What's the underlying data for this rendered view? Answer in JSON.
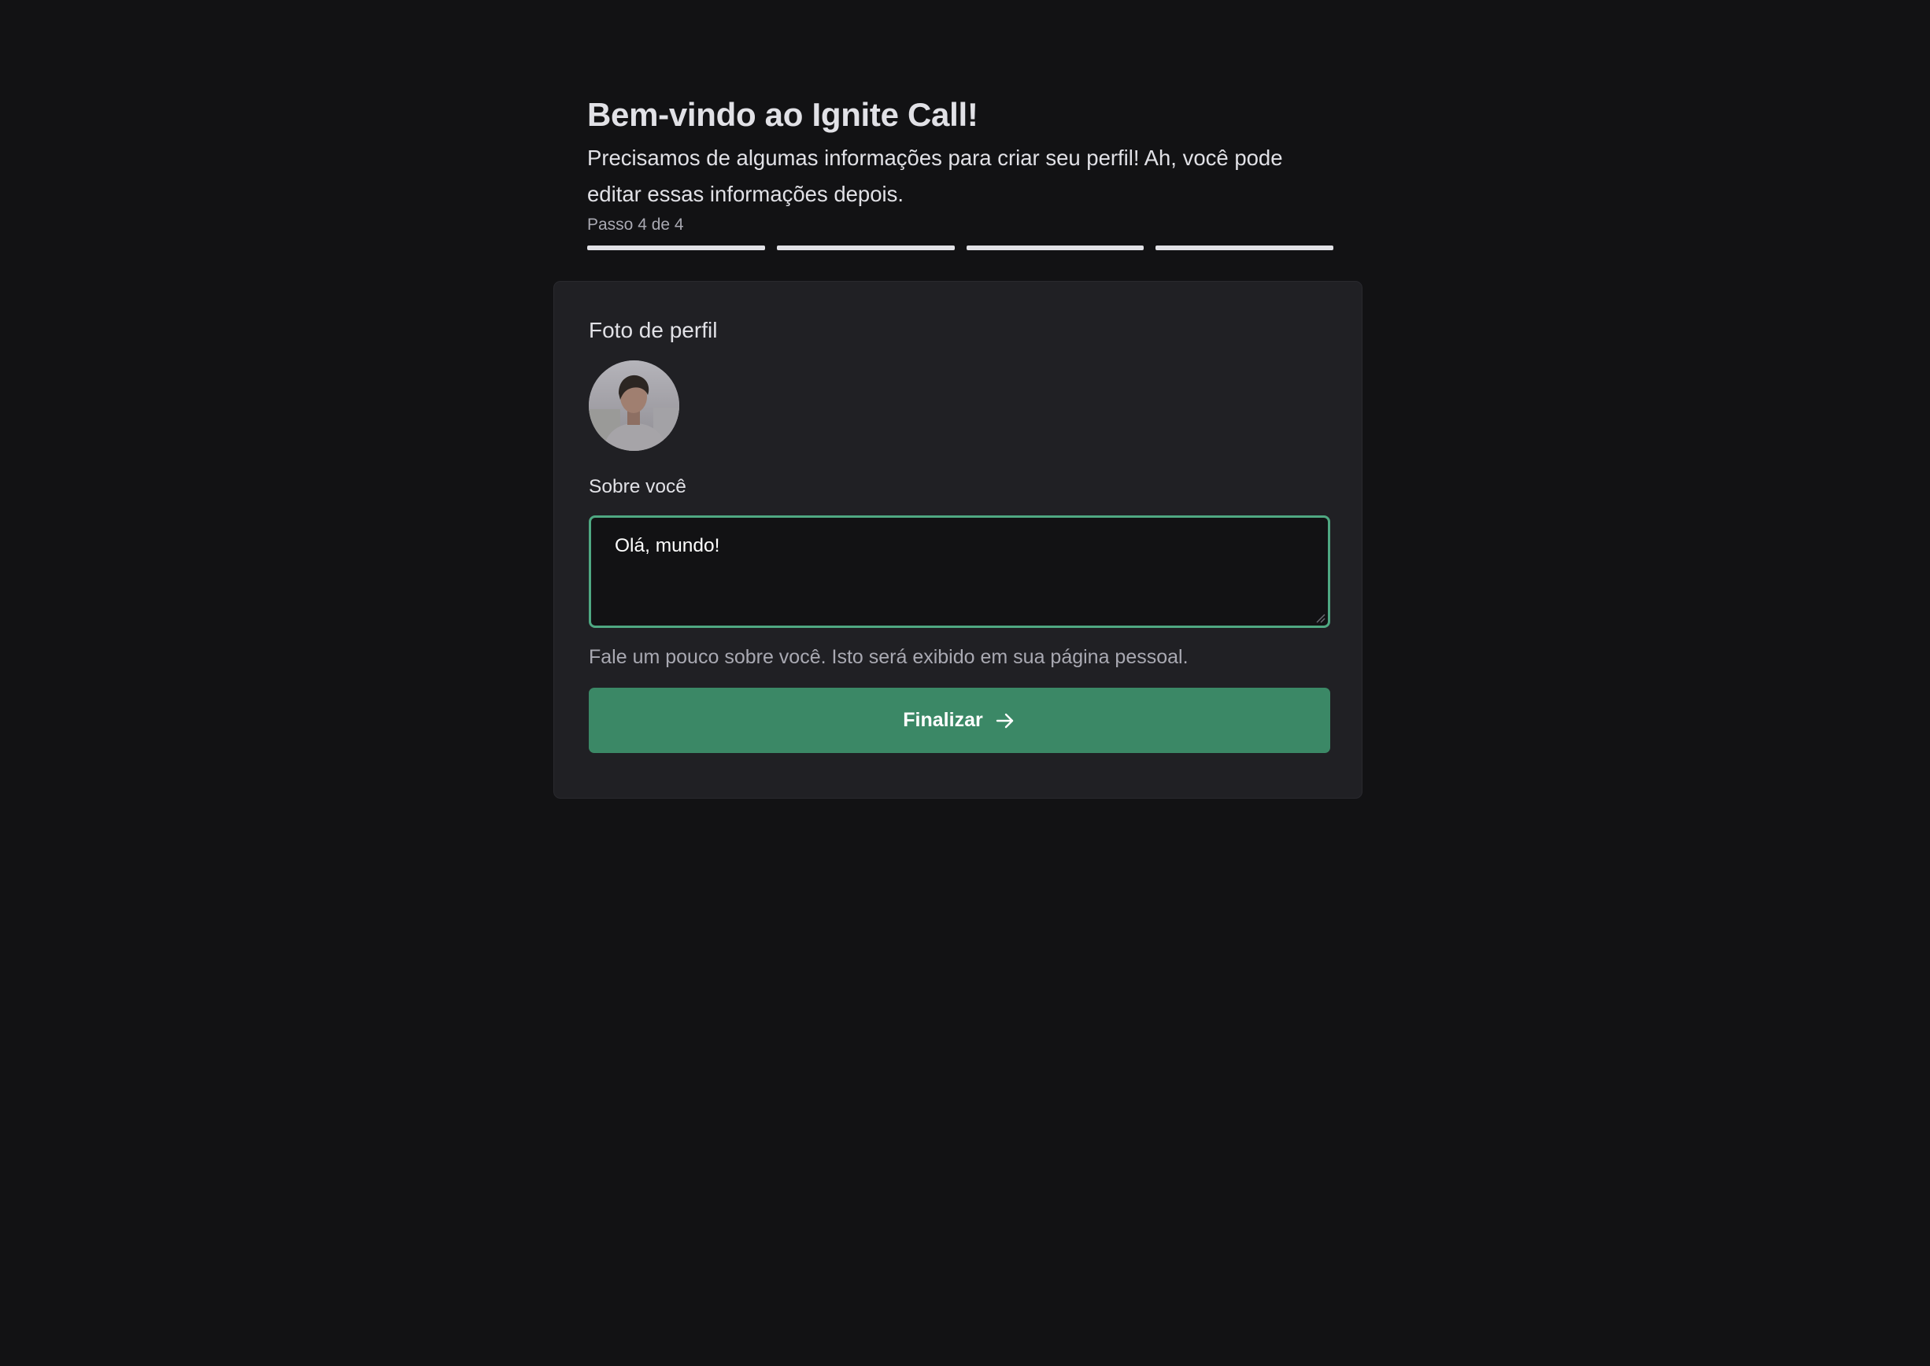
{
  "header": {
    "title": "Bem-vindo ao Ignite Call!",
    "subtitle": "Precisamos de algumas informações para criar seu perfil! Ah, você pode editar essas informações depois.",
    "step_label": "Passo 4 de 4",
    "steps_total": 4,
    "steps_completed": 4
  },
  "form": {
    "photo_label": "Foto de perfil",
    "avatar_icon": "profile-photo",
    "about_label": "Sobre você",
    "about_value": "Olá, mundo!",
    "about_hint": "Fale um pouco sobre você. Isto será exibido em sua página pessoal.",
    "submit_label": "Finalizar",
    "submit_icon": "arrow-right-icon"
  },
  "colors": {
    "background": "#121214",
    "card": "#202024",
    "accent": "#3b8866",
    "focus_border": "#4fa882",
    "text": "#e1e1e6",
    "muted": "#a9a9b2"
  }
}
